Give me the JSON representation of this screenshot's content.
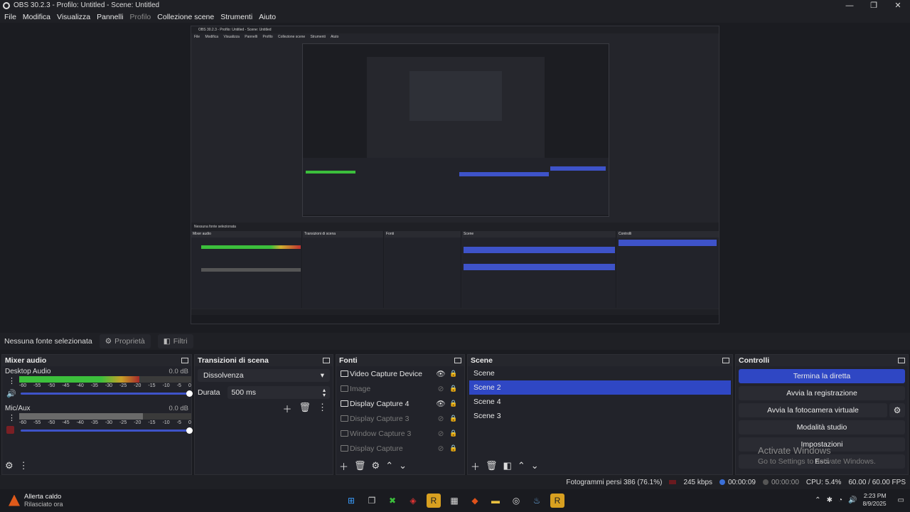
{
  "window": {
    "title": "OBS 30.2.3 - Profilo: Untitled - Scene: Untitled",
    "controls": [
      "—",
      "❐",
      "✕"
    ]
  },
  "menu": [
    {
      "label": "File",
      "enabled": true
    },
    {
      "label": "Modifica",
      "enabled": true
    },
    {
      "label": "Visualizza",
      "enabled": true
    },
    {
      "label": "Pannelli",
      "enabled": true
    },
    {
      "label": "Profilo",
      "enabled": false
    },
    {
      "label": "Collezione scene",
      "enabled": true
    },
    {
      "label": "Strumenti",
      "enabled": true
    },
    {
      "label": "Aiuto",
      "enabled": true
    }
  ],
  "preview": {
    "title": "OBS 30.2.3 - Profilo: Untitled - Scene: Untitled",
    "menu": [
      "File",
      "Modifica",
      "Visualizza",
      "Pannelli",
      "Profilo",
      "Collezione scene",
      "Strumenti",
      "Aiuto"
    ],
    "info": "Nessuna fonte selezionata",
    "panels": [
      "Mixer audio",
      "Transizioni di scena",
      "Fonti",
      "Scene",
      "Controlli"
    ]
  },
  "source_bar": {
    "none_selected": "Nessuna fonte selezionata",
    "properties": "Proprietà",
    "filters": "Filtri"
  },
  "mixer": {
    "title": "Mixer audio",
    "scale": [
      "-60",
      "-55",
      "-50",
      "-45",
      "-40",
      "-35",
      "-30",
      "-25",
      "-20",
      "-15",
      "-10",
      "-5",
      "0"
    ],
    "channels": [
      {
        "name": "Desktop Audio",
        "db": "0.0 dB",
        "level_fraction": 0.7,
        "muted": false
      },
      {
        "name": "Mic/Aux",
        "db": "0.0 dB",
        "level_fraction": 0.72,
        "muted": true
      }
    ]
  },
  "transitions": {
    "title": "Transizioni di scena",
    "selected": "Dissolvenza",
    "duration_label": "Durata",
    "duration_value": "500 ms"
  },
  "sources": {
    "title": "Fonti",
    "items": [
      {
        "label": "Video Capture Device",
        "visible": true,
        "icon": "camera-icon"
      },
      {
        "label": "Image",
        "visible": false,
        "icon": "image-icon"
      },
      {
        "label": "Display Capture 4",
        "visible": true,
        "icon": "monitor-icon"
      },
      {
        "label": "Display Capture 3",
        "visible": false,
        "icon": "monitor-icon"
      },
      {
        "label": "Window Capture 3",
        "visible": false,
        "icon": "window-icon"
      },
      {
        "label": "Display Capture",
        "visible": false,
        "icon": "monitor-icon"
      }
    ]
  },
  "scenes": {
    "title": "Scene",
    "items": [
      {
        "label": "Scene",
        "selected": false
      },
      {
        "label": "Scene 2",
        "selected": true
      },
      {
        "label": "Scene 4",
        "selected": false
      },
      {
        "label": "Scene 3",
        "selected": false
      }
    ]
  },
  "controls": {
    "title": "Controlli",
    "stop_stream": "Termina la diretta",
    "start_recording": "Avvia la registrazione",
    "virtual_camera": "Avvia la fotocamera virtuale",
    "studio_mode": "Modalità studio",
    "settings": "Impostazioni",
    "exit": "Esci"
  },
  "watermark": {
    "line1": "Activate Windows",
    "line2": "Go to Settings to activate Windows."
  },
  "status": {
    "dropped_frames": "Fotogrammi persi 386 (76.1%)",
    "bitrate": "245 kbps",
    "stream_time": "00:00:09",
    "record_time": "00:00:00",
    "cpu": "CPU: 5.4%",
    "fps": "60.00 / 60.00 FPS"
  },
  "taskbar": {
    "weather_title": "Allerta caldo",
    "weather_sub": "Rilasciato ora",
    "time": "2:23 PM",
    "date": "8/9/2025",
    "colors": {
      "accent": "#2f47c4",
      "alert": "#e05a1a"
    }
  }
}
